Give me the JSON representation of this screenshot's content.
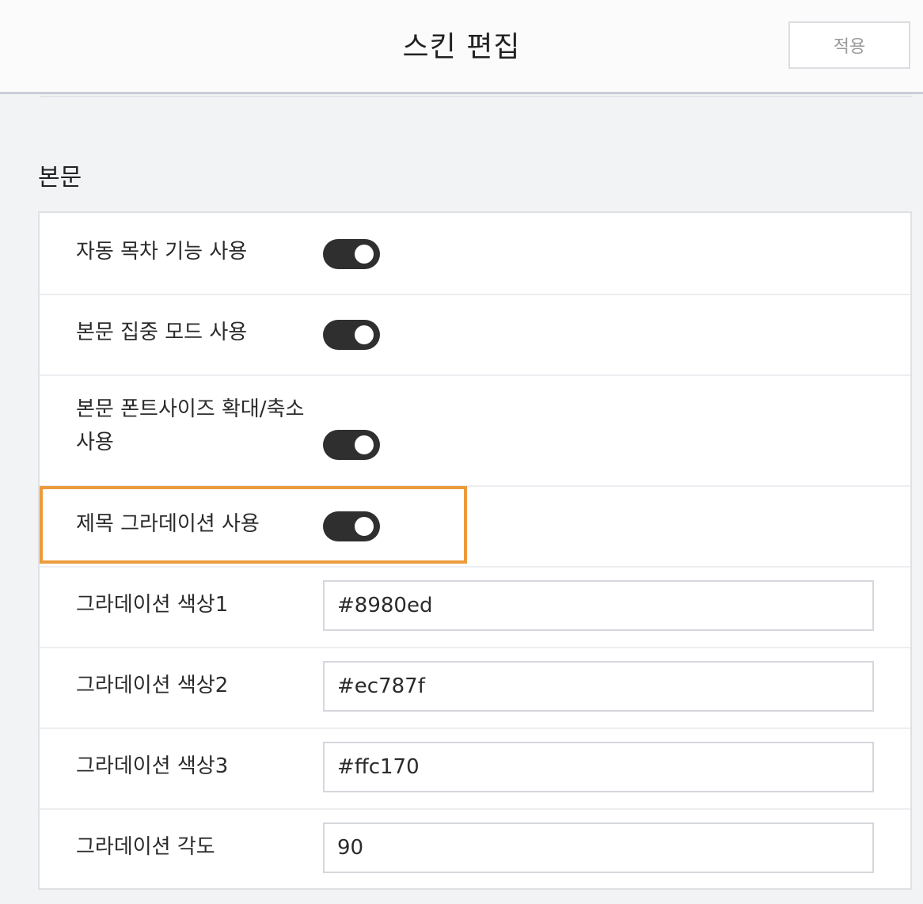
{
  "header": {
    "title": "스킨 편집",
    "apply_label": "적용"
  },
  "section": {
    "title": "본문"
  },
  "settings": {
    "toggles": [
      {
        "label": "자동 목차 기능 사용",
        "on": true
      },
      {
        "label": "본문 집중 모드 사용",
        "on": true
      },
      {
        "label_line1": "본문 폰트사이즈 확대/축소",
        "label_line2": "사용",
        "on": true
      },
      {
        "label": "제목 그라데이션 사용",
        "on": true
      }
    ],
    "fields": [
      {
        "label": "그라데이션 색상1",
        "value": "#8980ed"
      },
      {
        "label": "그라데이션 색상2",
        "value": "#ec787f"
      },
      {
        "label": "그라데이션 색상3",
        "value": "#ffc170"
      },
      {
        "label": "그라데이션 각도",
        "value": "90"
      }
    ]
  },
  "colors": {
    "toggle_on": "#2f2f2f",
    "highlight": "#ec9b3b"
  }
}
